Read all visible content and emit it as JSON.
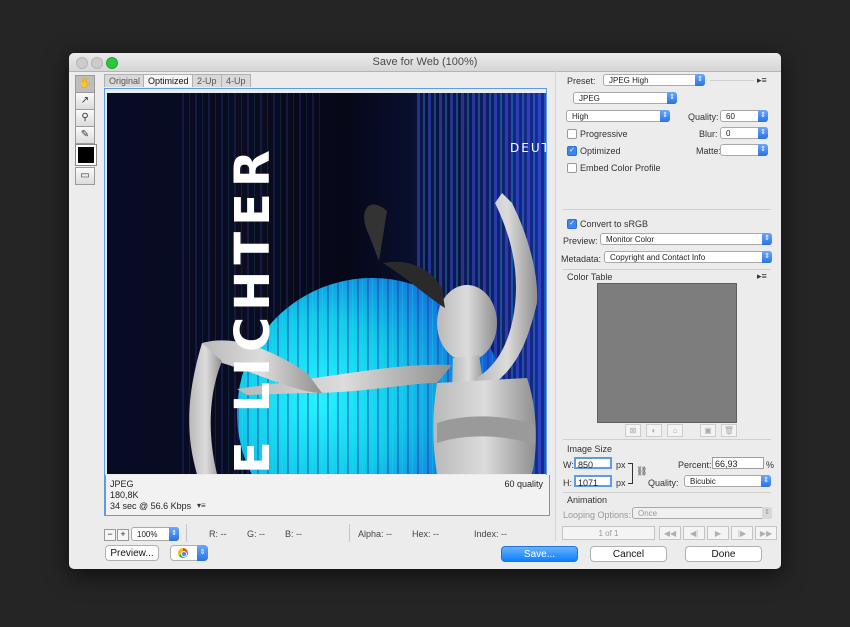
{
  "window": {
    "title": "Save for Web (100%)"
  },
  "tools": [
    {
      "icon": "hand-icon",
      "glyph": "✋"
    },
    {
      "icon": "slice-select-icon",
      "glyph": "↗"
    },
    {
      "icon": "zoom-icon",
      "glyph": "⚲"
    },
    {
      "icon": "eyedropper-icon",
      "glyph": "✎"
    }
  ],
  "tabs": [
    "Original",
    "Optimized",
    "2-Up",
    "4-Up"
  ],
  "preview": {
    "vertical_text": "E LICHTER",
    "corner_text": "DEUT",
    "format": "JPEG",
    "size": "180,8K",
    "download_time": "34 sec @ 56.6 Kbps",
    "quality_text": "60 quality"
  },
  "settings": {
    "preset_label": "Preset:",
    "preset_value": "JPEG High",
    "format_value": "JPEG",
    "quality_level": "High",
    "quality_label": "Quality:",
    "quality_value": "60",
    "progressive_label": "Progressive",
    "blur_label": "Blur:",
    "blur_value": "0",
    "optimized_label": "Optimized",
    "matte_label": "Matte:",
    "embed_label": "Embed Color Profile",
    "convert_label": "Convert to sRGB",
    "preview_label": "Preview:",
    "preview_value": "Monitor Color",
    "metadata_label": "Metadata:",
    "metadata_value": "Copyright and Contact Info",
    "color_table_label": "Color Table"
  },
  "image_size": {
    "title": "Image Size",
    "w_label": "W:",
    "w_value": "850",
    "h_label": "H:",
    "h_value": "1071",
    "unit": "px",
    "percent_label": "Percent:",
    "percent_value": "66,93",
    "percent_unit": "%",
    "quality_label": "Quality:",
    "quality_value": "Bicubic"
  },
  "animation": {
    "title": "Animation",
    "looping_label": "Looping Options:",
    "looping_value": "Once",
    "frame_counter": "1 of 1"
  },
  "status": {
    "zoom": "100%",
    "r": "R: --",
    "g": "G: --",
    "b": "B: --",
    "alpha": "Alpha: --",
    "hex": "Hex: --",
    "index": "Index: --"
  },
  "buttons": {
    "preview": "Preview...",
    "save": "Save...",
    "cancel": "Cancel",
    "done": "Done"
  },
  "colors": {
    "accent": "#2a73e0",
    "preview_bg": "#070b24",
    "cyan_glow": "#19e6f0"
  }
}
